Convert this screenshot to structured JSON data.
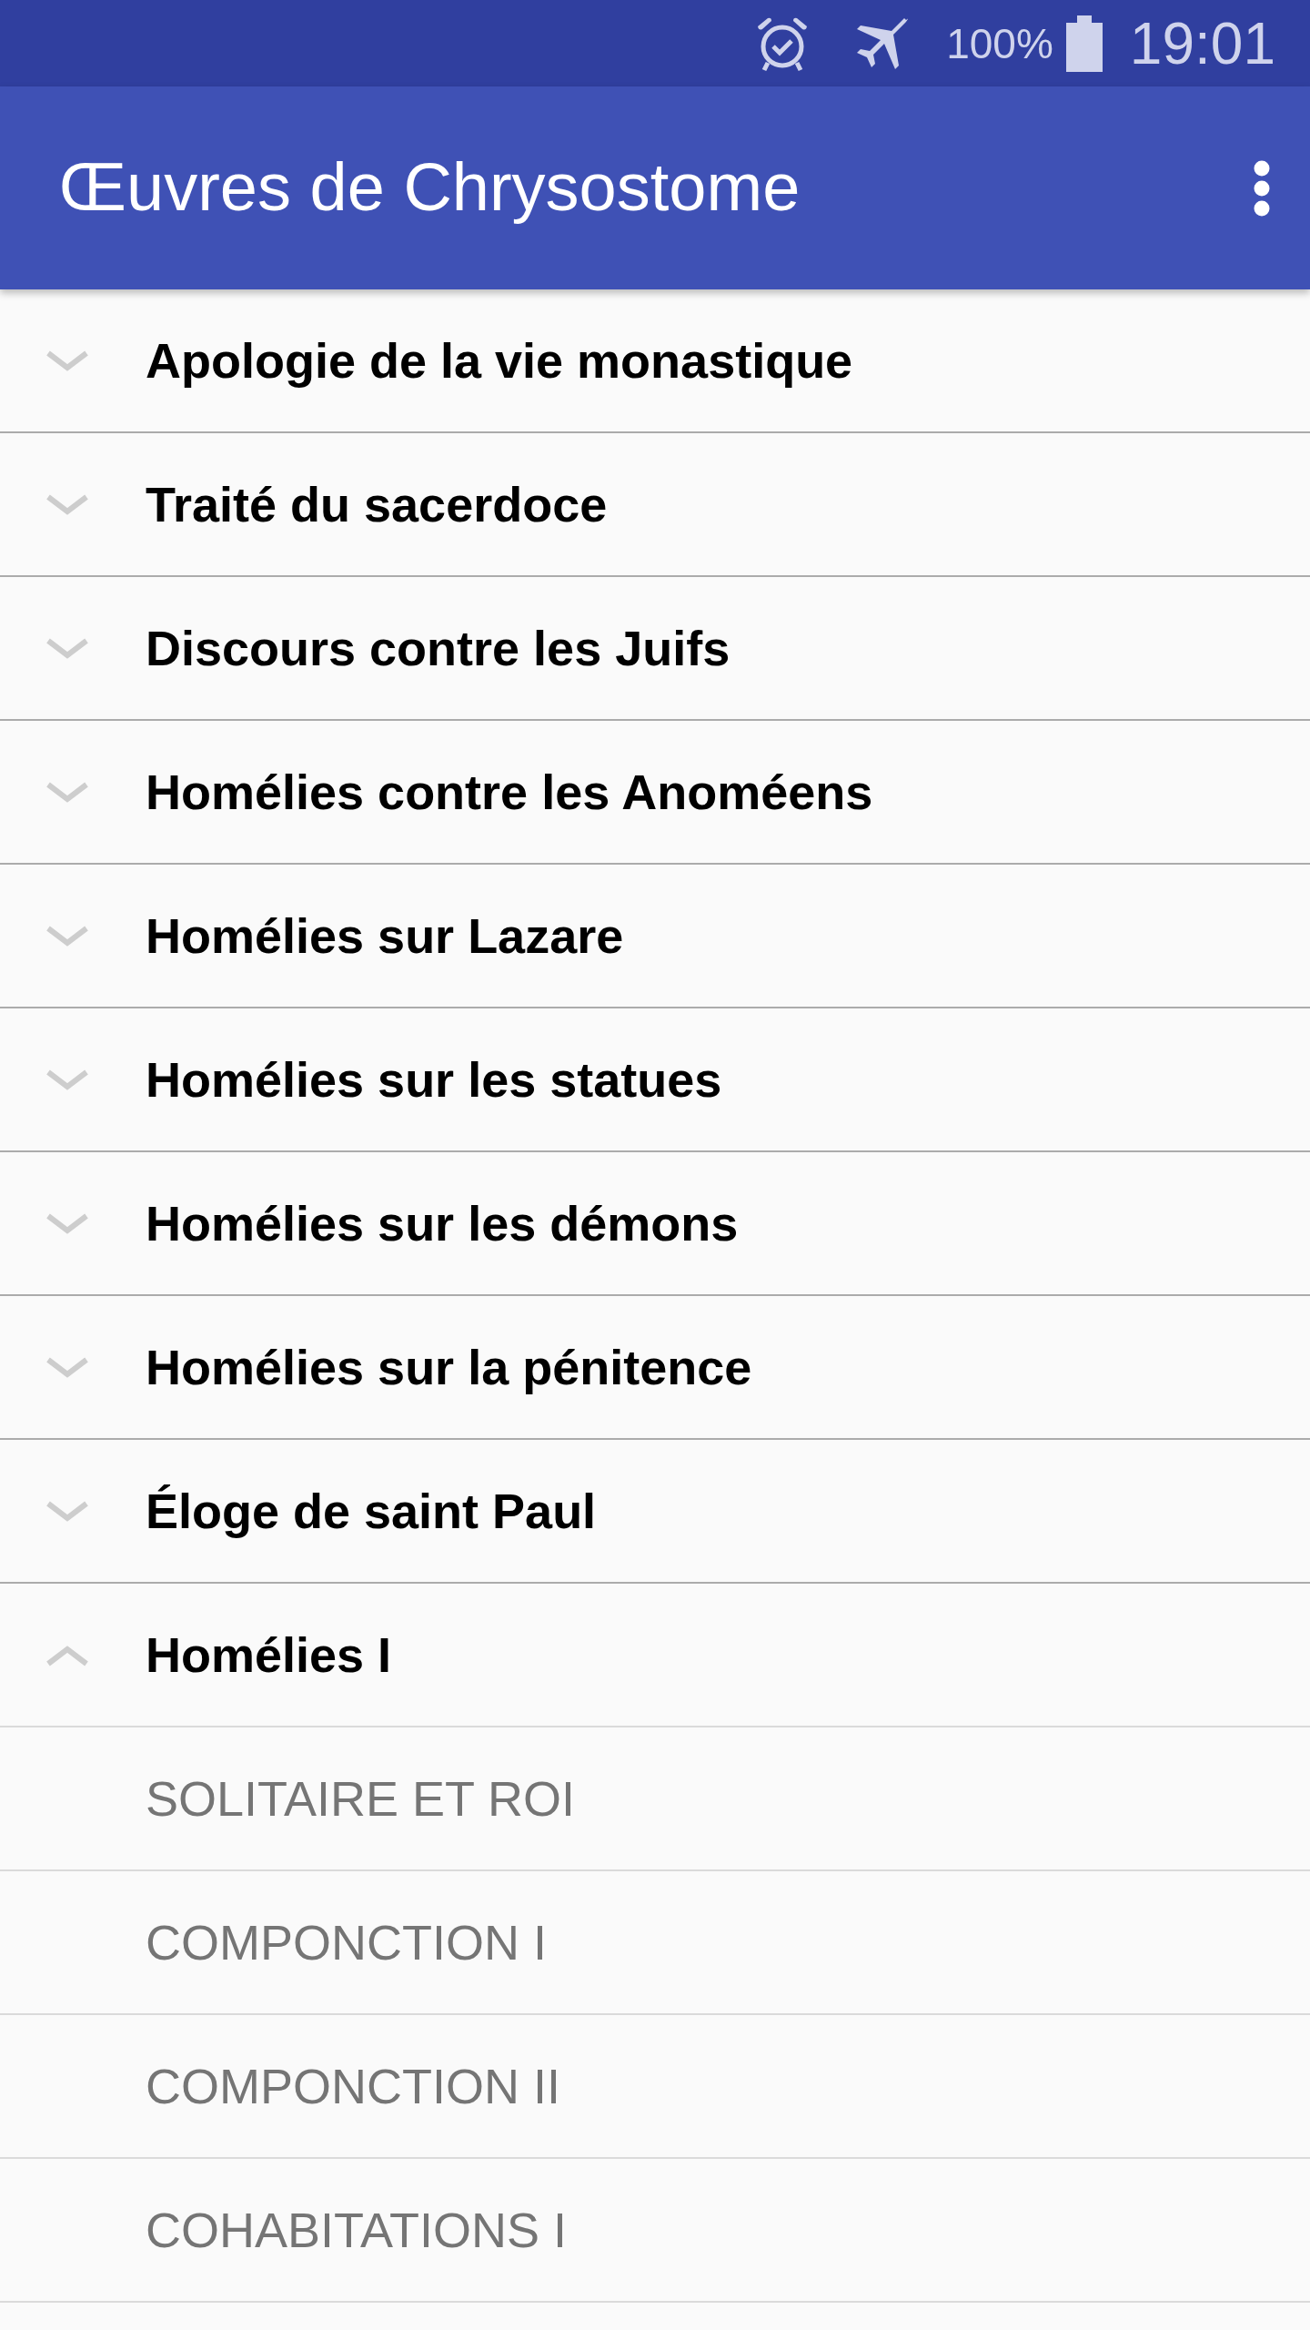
{
  "status_bar": {
    "battery_text": "100%",
    "time": "19:01"
  },
  "app_bar": {
    "title": "Œuvres de Chrysostome"
  },
  "works": [
    {
      "title": "Apologie de la vie monastique",
      "expanded": false
    },
    {
      "title": "Traité du sacerdoce",
      "expanded": false
    },
    {
      "title": "Discours contre les Juifs",
      "expanded": false
    },
    {
      "title": "Homélies contre les Anoméens",
      "expanded": false
    },
    {
      "title": "Homélies sur Lazare",
      "expanded": false
    },
    {
      "title": "Homélies sur les statues",
      "expanded": false
    },
    {
      "title": "Homélies sur les démons",
      "expanded": false
    },
    {
      "title": "Homélies sur la pénitence",
      "expanded": false
    },
    {
      "title": "Éloge de saint Paul",
      "expanded": false
    },
    {
      "title": "Homélies I",
      "expanded": true,
      "children": [
        {
          "title": "SOLITAIRE ET ROI"
        },
        {
          "title": "COMPONCTION I"
        },
        {
          "title": "COMPONCTION II"
        },
        {
          "title": "COHABITATIONS I"
        }
      ]
    }
  ]
}
